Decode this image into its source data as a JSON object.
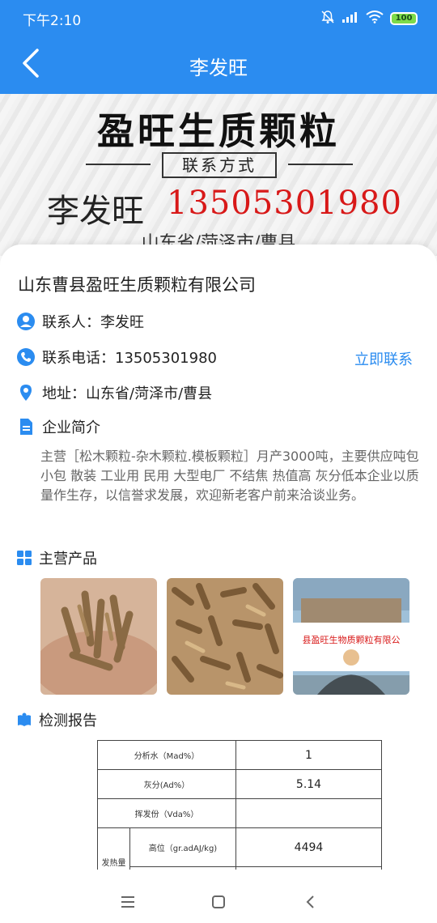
{
  "status": {
    "time": "下午2:10",
    "battery": "100"
  },
  "nav": {
    "title": "李发旺"
  },
  "banner": {
    "title": "盈旺生质颗粒",
    "subtitle": "联系方式",
    "name": "李发旺",
    "phone": "13505301980",
    "address": "山东省/菏泽市/曹县"
  },
  "card": {
    "company": "山东曹县盈旺生质颗粒有限公司",
    "contact_person": "联系人：李发旺",
    "phone_line": "联系电话：13505301980",
    "contact_now": "立即联系",
    "address_line": "地址：山东省/菏泽市/曹县",
    "intro_title": "企业简介",
    "intro_text": "主营［松木颗粒-杂木颗粒.模板颗粒］月产3000吨，主要供应吨包 小包 散装 工业用 民用  大型电厂 不结焦 热值高 灰分低本企业以质量作生存，以信誉求发展，欢迎新老客户前来洽谈业务。",
    "products_title": "主营产品",
    "report_title": "检测报告"
  },
  "products": [
    {
      "name": "pellets-in-hand"
    },
    {
      "name": "pellets-pile"
    },
    {
      "name": "company-sign"
    }
  ],
  "product_sign_text": "县盈旺生物质颗粒有限公",
  "report_rows": [
    {
      "label": "分析水（Mad%）",
      "value": "1"
    },
    {
      "label": "灰分(Ad%）",
      "value": "5.14"
    },
    {
      "label": "挥发份（Vda%）",
      "value": ""
    },
    {
      "label": "高位（gr.adAJ/kg)",
      "value": "4494"
    },
    {
      "label": "发热量",
      "value": ""
    }
  ],
  "colors": {
    "accent": "#2b8cf0",
    "phone_red": "#d81818"
  }
}
